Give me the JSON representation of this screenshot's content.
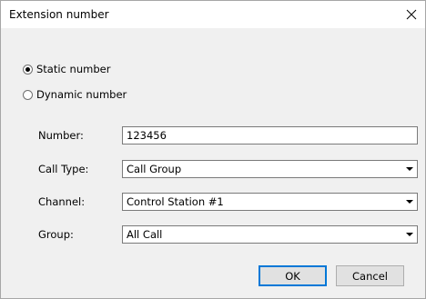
{
  "window": {
    "title": "Extension number"
  },
  "mode": {
    "options": [
      {
        "label": "Static number",
        "selected": true
      },
      {
        "label": "Dynamic number",
        "selected": false
      }
    ]
  },
  "fields": {
    "number": {
      "label": "Number:",
      "value": "123456"
    },
    "call_type": {
      "label": "Call Type:",
      "value": "Call Group"
    },
    "channel": {
      "label": "Channel:",
      "value": "Control Station #1"
    },
    "group": {
      "label": "Group:",
      "value": "All Call"
    }
  },
  "buttons": {
    "ok": "OK",
    "cancel": "Cancel"
  },
  "icons": {
    "close": "close-icon",
    "dropdown": "chevron-down-icon"
  },
  "colors": {
    "focus_border": "#0078d7",
    "client_bg": "#f0f0f0"
  }
}
